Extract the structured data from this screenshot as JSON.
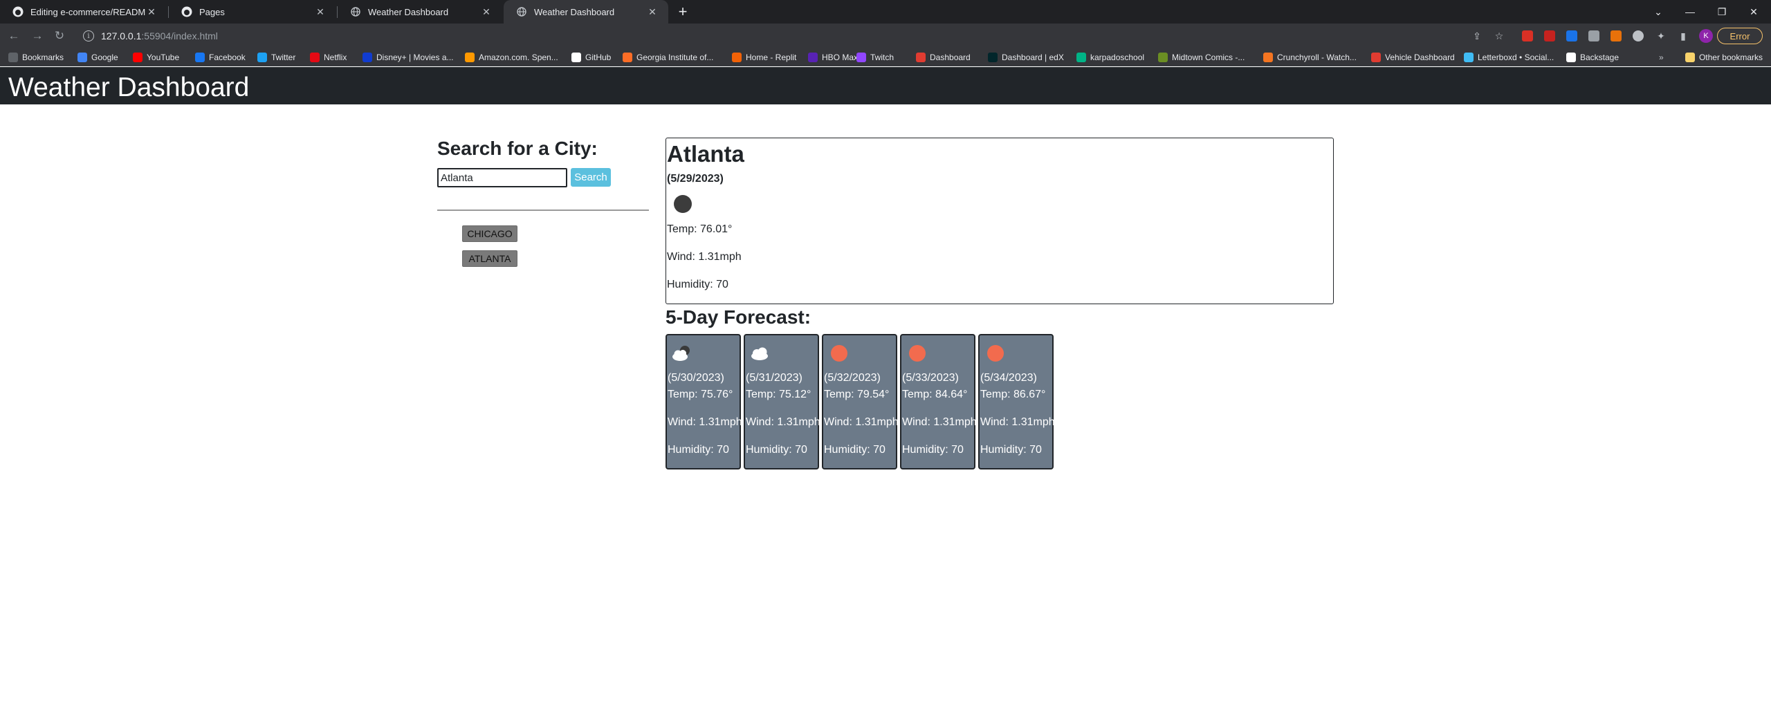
{
  "browser": {
    "tabs": [
      {
        "title": "Editing e-commerce/README.m",
        "icon": "github-icon"
      },
      {
        "title": "Pages",
        "icon": "github-icon"
      },
      {
        "title": "Weather Dashboard",
        "icon": "globe-icon"
      },
      {
        "title": "Weather Dashboard",
        "icon": "globe-icon",
        "active": true
      }
    ],
    "url_host": "127.0.0.1",
    "url_path": ":55904/index.html",
    "avatar_letter": "K",
    "error_label": "Error",
    "bookmarks": [
      {
        "label": "Bookmarks",
        "color": "#5f6368"
      },
      {
        "label": "Google",
        "color": "#4285f4"
      },
      {
        "label": "YouTube",
        "color": "#ff0000"
      },
      {
        "label": "Facebook",
        "color": "#1877f2"
      },
      {
        "label": "Twitter",
        "color": "#1da1f2"
      },
      {
        "label": "Netflix",
        "color": "#e50914"
      },
      {
        "label": "Disney+ | Movies a...",
        "color": "#113ccf"
      },
      {
        "label": "Amazon.com. Spen...",
        "color": "#ff9900"
      },
      {
        "label": "GitHub",
        "color": "#ffffff"
      },
      {
        "label": "Georgia Institute of...",
        "color": "#fc6d26"
      },
      {
        "label": "Home - Replit",
        "color": "#f26207"
      },
      {
        "label": "HBO Max",
        "color": "#5822b4"
      },
      {
        "label": "Twitch",
        "color": "#9146ff"
      },
      {
        "label": "Dashboard",
        "color": "#e03c31"
      },
      {
        "label": "Dashboard | edX",
        "color": "#02262b"
      },
      {
        "label": "karpadoschool",
        "color": "#00b386"
      },
      {
        "label": "Midtown Comics -...",
        "color": "#6b8e23"
      },
      {
        "label": "Crunchyroll - Watch...",
        "color": "#f47521"
      },
      {
        "label": "Vehicle Dashboard",
        "color": "#e03c31"
      },
      {
        "label": "Letterboxd • Social...",
        "color": "#40bcf4"
      },
      {
        "label": "Backstage",
        "color": "#ffffff"
      }
    ],
    "other_bookmarks": "Other bookmarks"
  },
  "header": {
    "title": "Weather Dashboard"
  },
  "search": {
    "heading": "Search for a City:",
    "value": "Atlanta",
    "button_label": "Search"
  },
  "history": [
    "CHICAGO",
    "ATLANTA"
  ],
  "current": {
    "city": "Atlanta",
    "date": "(5/29/2023)",
    "icon": "moon-icon",
    "temp": "Temp: 76.01°",
    "wind": "Wind: 1.31mph",
    "humidity": "Humidity: 70"
  },
  "forecast": {
    "heading": "5-Day Forecast:",
    "days": [
      {
        "icon": "partly-cloudy-night-icon",
        "date": "(5/30/2023)",
        "temp": "Temp: 75.76°",
        "wind": "Wind: 1.31mph",
        "humidity": "Humidity: 70"
      },
      {
        "icon": "cloud-icon",
        "date": "(5/31/2023)",
        "temp": "Temp: 75.12°",
        "wind": "Wind: 1.31mph",
        "humidity": "Humidity: 70"
      },
      {
        "icon": "sun-icon",
        "date": "(5/32/2023)",
        "temp": "Temp: 79.54°",
        "wind": "Wind: 1.31mph",
        "humidity": "Humidity: 70"
      },
      {
        "icon": "sun-icon",
        "date": "(5/33/2023)",
        "temp": "Temp: 84.64°",
        "wind": "Wind: 1.31mph",
        "humidity": "Humidity: 70"
      },
      {
        "icon": "sun-icon",
        "date": "(5/34/2023)",
        "temp": "Temp: 86.67°",
        "wind": "Wind: 1.31mph",
        "humidity": "Humidity: 70"
      }
    ]
  }
}
